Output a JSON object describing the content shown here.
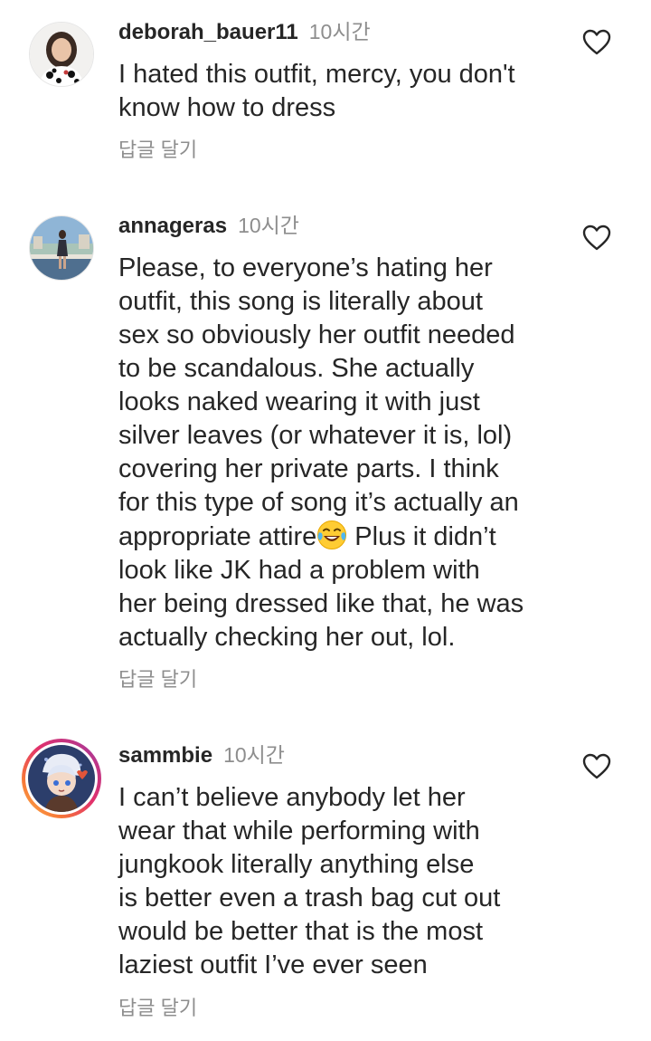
{
  "comments": [
    {
      "username": "deborah_bauer11",
      "time": "10시간",
      "text": "I hated this outfit, mercy, you don't\nknow how to dress",
      "reply_label": "답글 달기",
      "like_icon": "heart-outline-icon"
    },
    {
      "username": "annageras",
      "time": "10시간",
      "text_before_emoji": "Please, to everyone’s hating her\noutfit, this song is literally about\nsex so obviously her outfit needed\nto be scandalous. She actually\nlooks naked wearing it with just\nsilver leaves (or whatever it is, lol)\ncovering her private parts. I think\nfor this type of song it’s actually an\nappropriate attire",
      "emoji": "face-with-tears-of-joy",
      "text_after_emoji": " Plus it didn’t\nlook like JK had a problem with\nher being dressed like that, he was\nactually checking her out, lol.",
      "reply_label": "답글 달기",
      "like_icon": "heart-outline-icon"
    },
    {
      "username": "sammbie",
      "time": "10시간",
      "text": "I can’t believe anybody let her\nwear that while performing with\njungkook literally anything else\nis better even a trash bag cut out\nwould be better that is the most\nlaziest outfit I’ve ever seen",
      "reply_label": "답글 달기",
      "like_icon": "heart-outline-icon",
      "has_story_ring": true
    }
  ],
  "colors": {
    "text": "#262626",
    "secondary": "#8e8e8e",
    "background": "#ffffff"
  }
}
